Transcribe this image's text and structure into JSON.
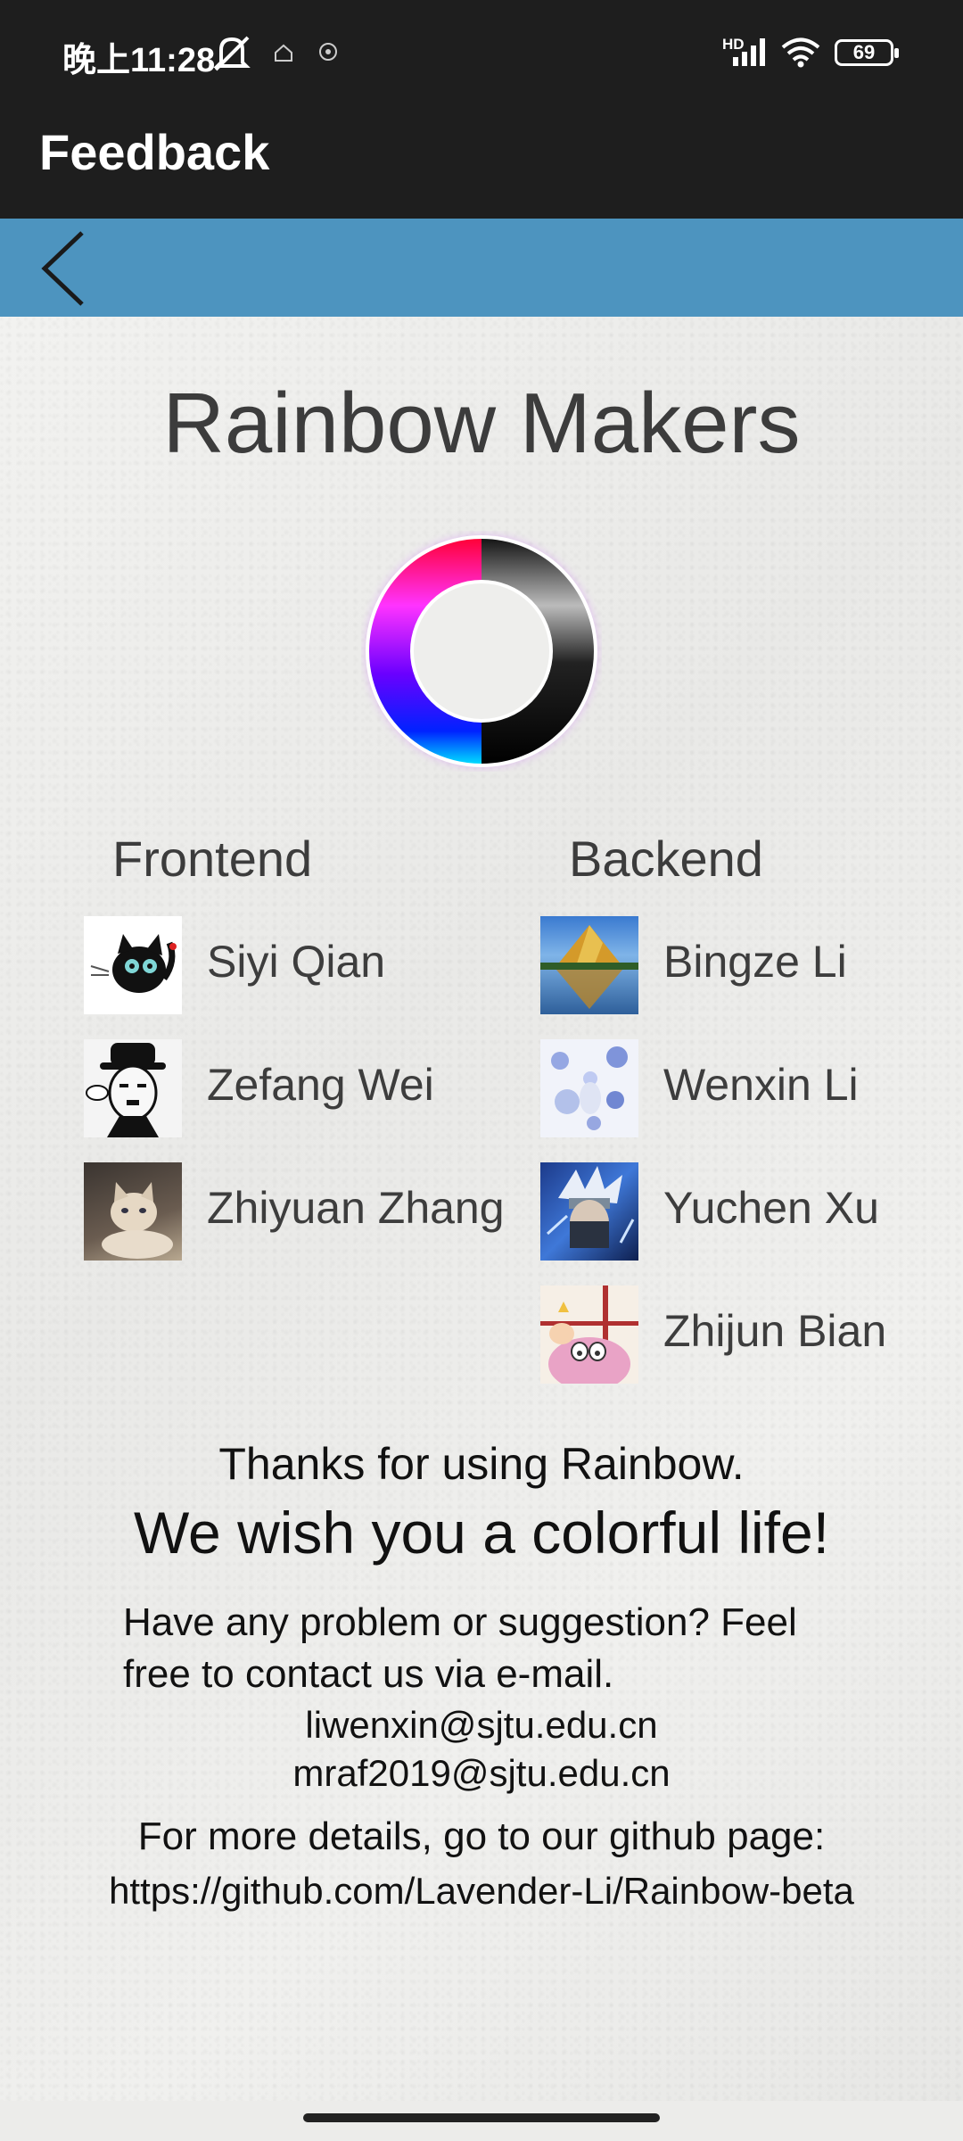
{
  "status_bar": {
    "time": "晚上11:28",
    "network": "HD",
    "battery": "69",
    "icons": [
      "mute-icon",
      "home-icon",
      "compass-icon",
      "signal-icon",
      "wifi-icon",
      "battery-icon"
    ]
  },
  "app_bar": {
    "title": "Feedback"
  },
  "nav_bar": {
    "back_icon": "chevron-left-icon",
    "color": "#4d94bf"
  },
  "main": {
    "heading": "Rainbow Makers",
    "frontend": {
      "title": "Frontend",
      "members": [
        {
          "name": "Siyi Qian",
          "avatar": "cat-avatar"
        },
        {
          "name": "Zefang Wei",
          "avatar": "chaplin-avatar"
        },
        {
          "name": "Zhiyuan Zhang",
          "avatar": "kitten-avatar"
        }
      ]
    },
    "backend": {
      "title": "Backend",
      "members": [
        {
          "name": "Bingze Li",
          "avatar": "mountain-avatar"
        },
        {
          "name": "Wenxin Li",
          "avatar": "blue-flowers-avatar"
        },
        {
          "name": "Yuchen Xu",
          "avatar": "ninja-avatar"
        },
        {
          "name": "Zhijun Bian",
          "avatar": "cartoon-avatar"
        }
      ]
    },
    "thanks": "Thanks for using Rainbow.",
    "wish": "We wish you a colorful life!",
    "contact": "Have any problem or suggestion? Feel free to contact us via e-mail.",
    "emails": [
      "liwenxin@sjtu.edu.cn",
      "mraf2019@sjtu.edu.cn"
    ],
    "more": "For more details, go to our github page:",
    "github": "https://github.com/Lavender-Li/Rainbow-beta"
  }
}
